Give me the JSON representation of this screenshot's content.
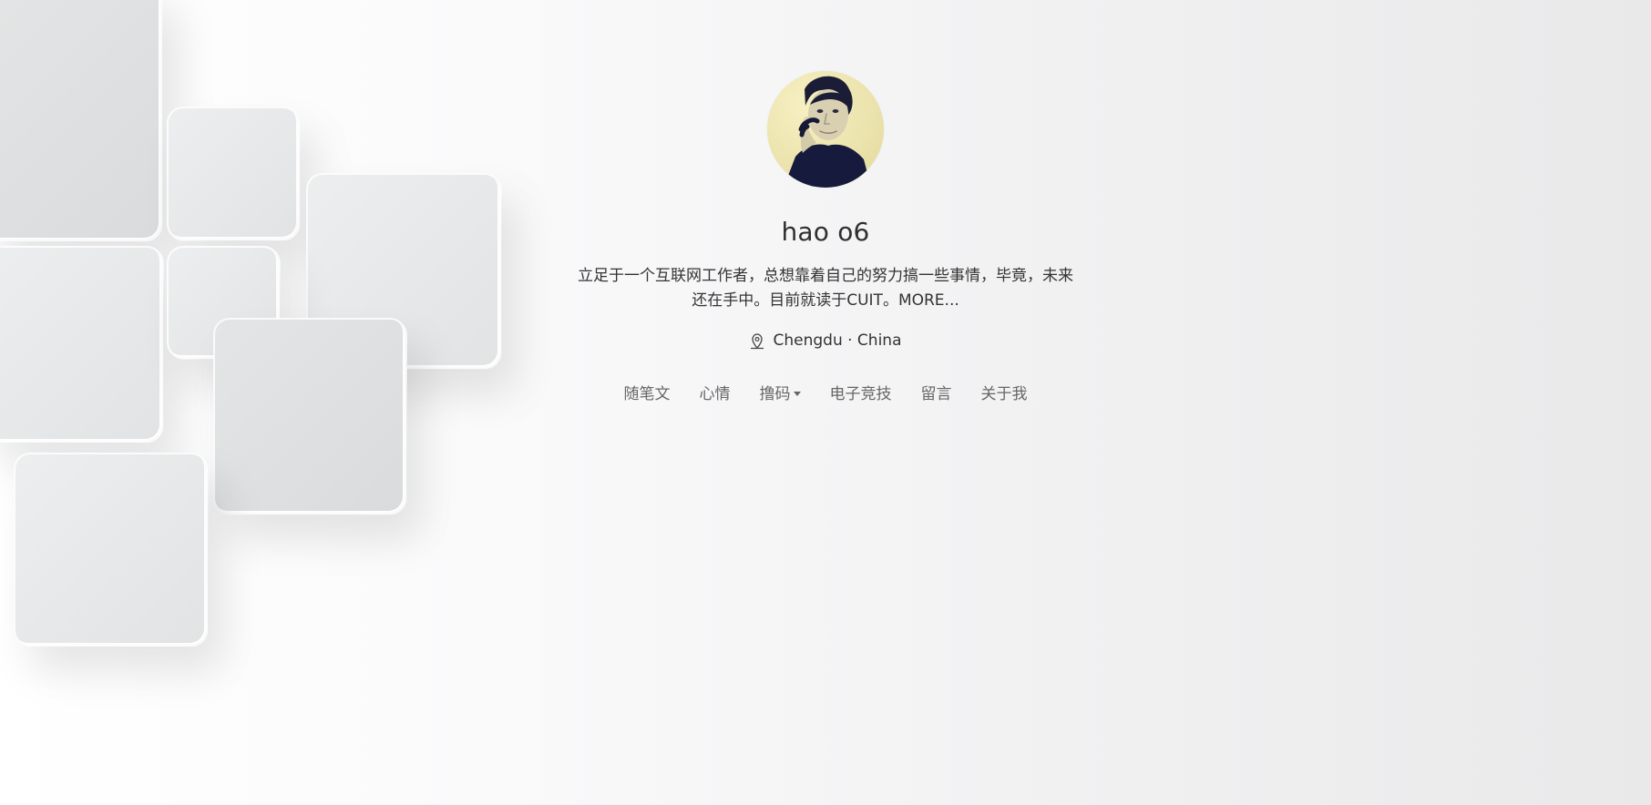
{
  "profile": {
    "name": "hao o6",
    "bio": "立足于一个互联网工作者，总想靠着自己的努力搞一些事情，毕竟，未来还在手中。目前就读于CUIT。MORE...",
    "location": "Chengdu · China"
  },
  "icons": {
    "avatar": "profile-photo",
    "location": "location-pin-icon",
    "dropdown": "caret-down-icon"
  },
  "nav": {
    "items": [
      {
        "label": "随笔文"
      },
      {
        "label": "心情"
      },
      {
        "label": "撸码",
        "has_dropdown": true
      },
      {
        "label": "电子竞技"
      },
      {
        "label": "留言"
      },
      {
        "label": "关于我"
      }
    ]
  },
  "colors": {
    "background_left": "#ffffff",
    "background_right": "#e9e9ea",
    "text_primary": "#333333",
    "text_nav": "#666666",
    "tile": "#e5e7e8"
  }
}
